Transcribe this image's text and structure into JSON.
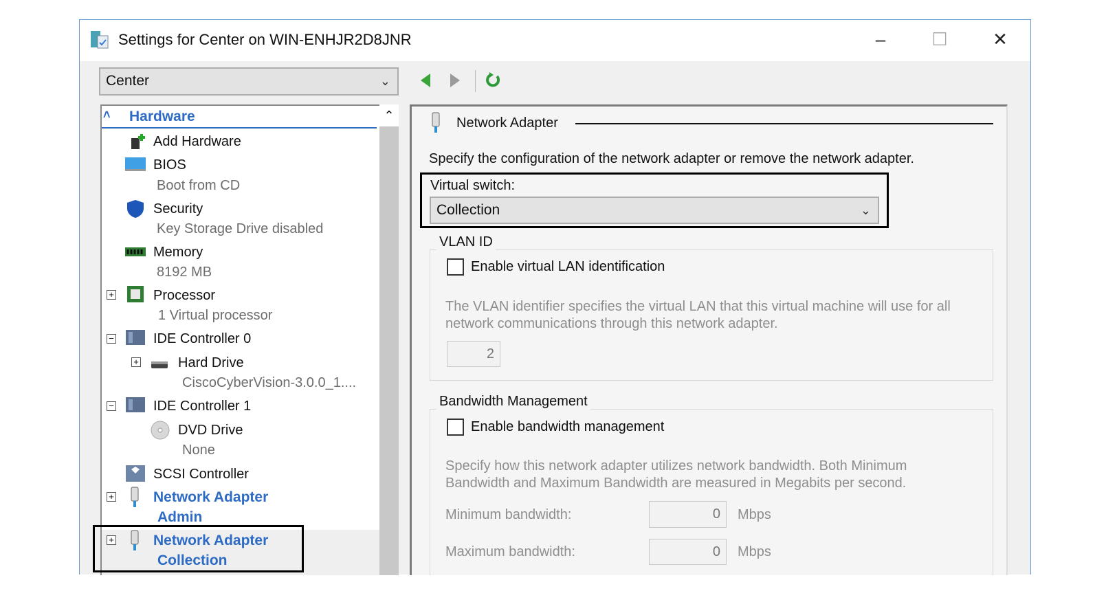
{
  "window": {
    "title": "Settings for Center on WIN-ENHJR2D8JNR",
    "minimize": "–",
    "maximize": "☐",
    "close": "✕"
  },
  "vm_selector": {
    "value": "Center"
  },
  "tree": {
    "section": "Hardware",
    "items": [
      {
        "label": "Add Hardware"
      },
      {
        "label": "BIOS",
        "sub": "Boot from CD"
      },
      {
        "label": "Security",
        "sub": "Key Storage Drive disabled"
      },
      {
        "label": "Memory",
        "sub": "8192 MB"
      },
      {
        "label": "Processor",
        "sub": "1 Virtual processor"
      },
      {
        "label": "IDE Controller 0"
      },
      {
        "label": "Hard Drive",
        "sub": "CiscoCyberVision-3.0.0_1...."
      },
      {
        "label": "IDE Controller 1"
      },
      {
        "label": "DVD Drive",
        "sub": "None"
      },
      {
        "label": "SCSI Controller"
      },
      {
        "label": "Network Adapter",
        "sub": "Admin"
      },
      {
        "label": "Network Adapter",
        "sub": "Collection"
      }
    ]
  },
  "panel": {
    "title": "Network Adapter",
    "description": "Specify the configuration of the network adapter or remove the network adapter.",
    "virtual_switch_label": "Virtual switch:",
    "virtual_switch_value": "Collection",
    "vlan": {
      "title": "VLAN ID",
      "checkbox": "Enable virtual LAN identification",
      "checked": false,
      "help1": "The VLAN identifier specifies the virtual LAN that this virtual machine will use for all",
      "help2": "network communications through this network adapter.",
      "value": "2"
    },
    "bandwidth": {
      "title": "Bandwidth Management",
      "checkbox": "Enable bandwidth management",
      "checked": false,
      "help1": "Specify how this network adapter utilizes network bandwidth. Both Minimum",
      "help2": "Bandwidth and Maximum Bandwidth are measured in Megabits per second.",
      "min_label": "Minimum bandwidth:",
      "min_value": "0",
      "max_label": "Maximum bandwidth:",
      "max_value": "0",
      "unit": "Mbps"
    }
  },
  "colors": {
    "accent": "#2d6bc4",
    "nav_green": "#3aa33a"
  }
}
